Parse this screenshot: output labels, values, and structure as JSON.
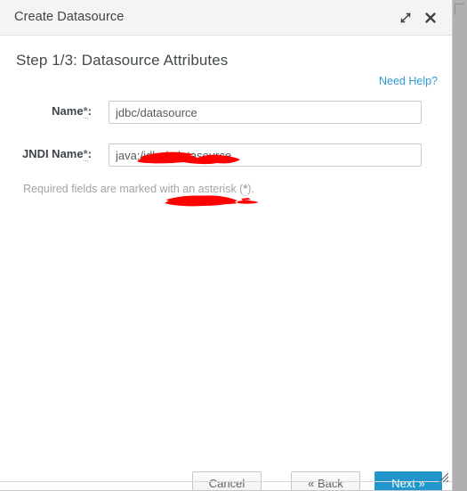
{
  "dialog": {
    "title": "Create Datasource",
    "titlebar_buttons": [
      {
        "name": "maximize-btn",
        "icon": "expand-diagonal-icon",
        "label": ""
      },
      {
        "name": "close-btn",
        "icon": "close-icon",
        "label": ""
      }
    ],
    "step_title": "Step 1/3: Datasource Attributes",
    "help_link": "Need Help?",
    "required_note_prefix": "Required fields are marked with an asterisk (",
    "required_note_asterisk": "*",
    "required_note_suffix": ").",
    "asterisk": "*"
  },
  "form": {
    "fields": [
      {
        "label": "Name",
        "label_suffix": ":",
        "value": "jdbc/datasource",
        "value_prefix": "jdbc/",
        "value_suffix": "datasource",
        "placeholder": "",
        "required": true,
        "redacted": true
      },
      {
        "label": "JNDI Name",
        "label_suffix": ":",
        "value": "java:/jdbc/_datasource",
        "value_prefix": "java:/jdbc/",
        "value_suffix": "_datasource",
        "placeholder": "",
        "required": true,
        "redacted": true
      }
    ]
  },
  "footer": {
    "cancel_label": "Cancel",
    "back_label": "« Back",
    "next_label": "Next »"
  },
  "colors": {
    "accent": "#2196cd",
    "link": "#2d9bd4",
    "titlebar_bg": "#f4f4f4",
    "text": "#3f4448",
    "muted_text": "#a0a5a8",
    "redaction": "#fe0000",
    "border": "#cccccc"
  }
}
